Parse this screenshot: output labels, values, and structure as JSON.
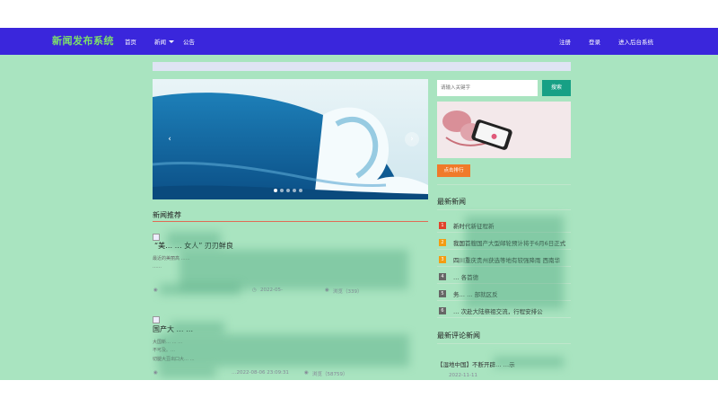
{
  "brand": "新闻发布系统",
  "nav": {
    "home": "首页",
    "news": "新闻",
    "notice": "公告",
    "register": "注册",
    "login": "登录",
    "admin": "进入后台系统"
  },
  "carousel": {
    "prev": "‹",
    "next": "›",
    "slides": 5,
    "active": 1
  },
  "section": {
    "recommend": "新闻推荐"
  },
  "articles": [
    {
      "title": "“美…                    … 女人”  刃刃鲜良",
      "text1": "最近的美丽高 ……",
      "text2": "……",
      "meta_views": "浏览（339）",
      "meta_date": "2022-05-"
    },
    {
      "title": "国产大 …                      …",
      "text1": "大国新…  …  …",
      "text2": "不可及。…",
      "text3": "切腿大豆出口大…    …",
      "meta_time": "…2022-08-06 23:09:31",
      "meta_views": "浏览（58759）"
    }
  ],
  "search": {
    "placeholder": "请输入关键字",
    "button": "搜索"
  },
  "hot_button": "点击排行",
  "latest": {
    "title": "最新新闻",
    "items": [
      {
        "num": "1",
        "text": "新时代新征程新"
      },
      {
        "num": "2",
        "text": "我国首艘国产大型邮轮预计将于6月6日正式"
      },
      {
        "num": "3",
        "text": "四川重庆贵州获选等地有较强降雨 西南华"
      },
      {
        "num": "4",
        "text": "… 各首德"
      },
      {
        "num": "5",
        "text": "务…   … 部就区反"
      },
      {
        "num": "6",
        "text": "…  次赴大陆祭祖交流，行程安排公"
      }
    ]
  },
  "comments": {
    "title": "最新评论新闻",
    "items": [
      {
        "text": "【湿地中国】不断开辟…   …示",
        "date": "2022-11-11"
      }
    ]
  },
  "colors": {
    "navbar": "#3a26dc",
    "brand": "#7ee06a",
    "main_bg": "#a9e4c0",
    "search_btn": "#17a085",
    "hot_btn": "#f07a2a",
    "badge_red": "#e0412b",
    "badge_orange": "#f39c12",
    "badge_gray": "#666666"
  }
}
